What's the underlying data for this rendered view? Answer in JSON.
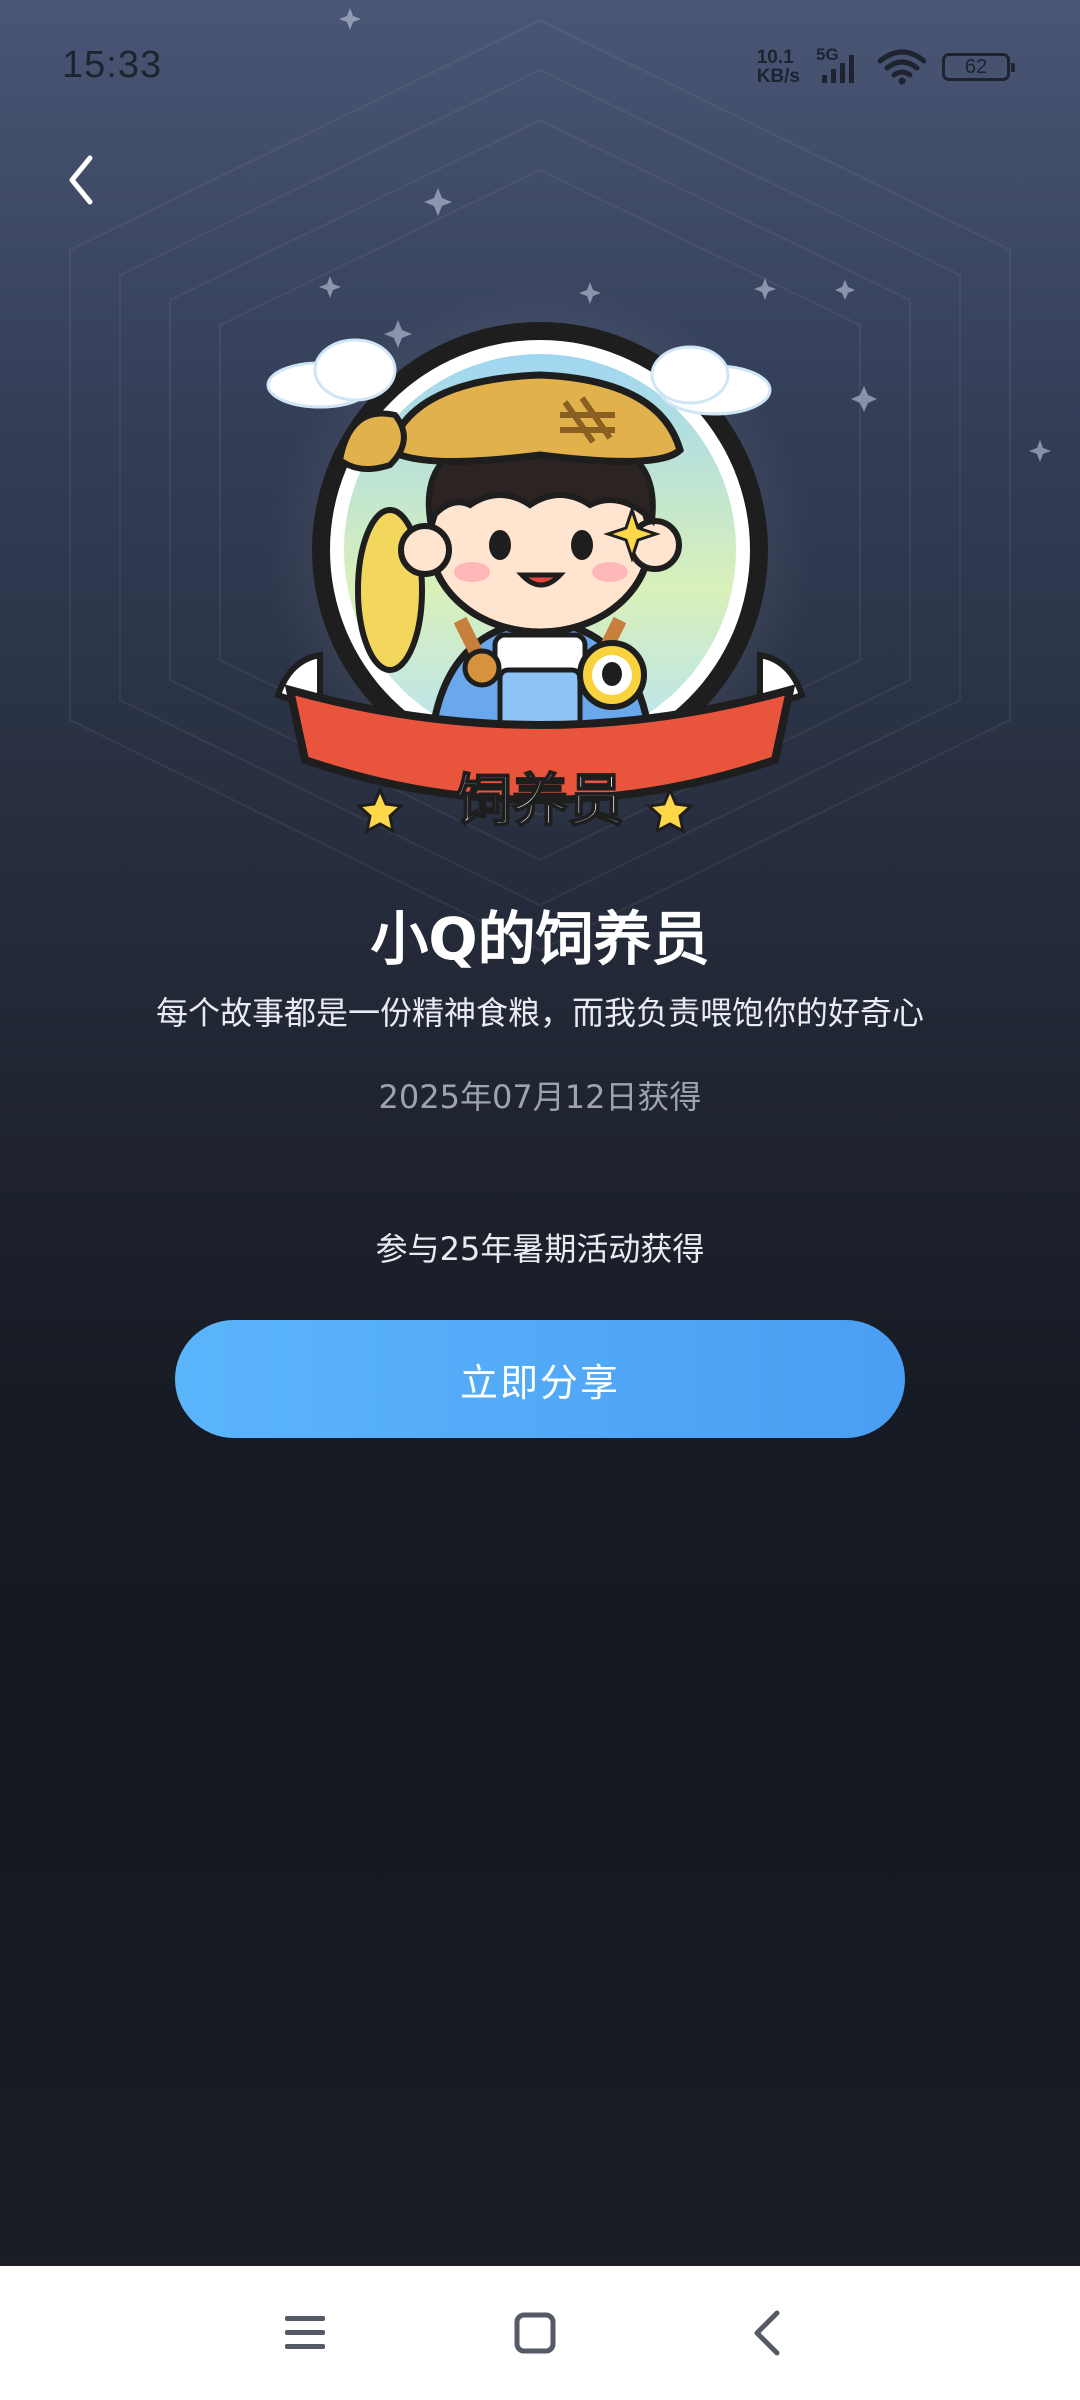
{
  "status_bar": {
    "time": "15:33",
    "net_speed_value": "10.1",
    "net_speed_unit": "KB/s",
    "network_type": "5G",
    "battery_level": "62",
    "icons": [
      "signal-icon",
      "wifi-icon",
      "battery-icon"
    ]
  },
  "header": {
    "back_icon": "chevron-left-icon"
  },
  "badge": {
    "ribbon_text": "饲养员",
    "colors": {
      "ribbon": "#e8553c",
      "ring": "#1e1e1e",
      "sky": "#9fd6f2"
    }
  },
  "achievement": {
    "title": "小Q的饲养员",
    "description": "每个故事都是一份精神食粮，而我负责喂饱你的好奇心",
    "date": "2025年07月12日获得",
    "source": "参与25年暑期活动获得"
  },
  "share_button": {
    "label": "立即分享",
    "color_start": "#5bb5fb",
    "color_end": "#4a9ef3"
  },
  "nav_bar": {
    "icons": [
      "menu-icon",
      "home-square-icon",
      "back-icon"
    ]
  }
}
